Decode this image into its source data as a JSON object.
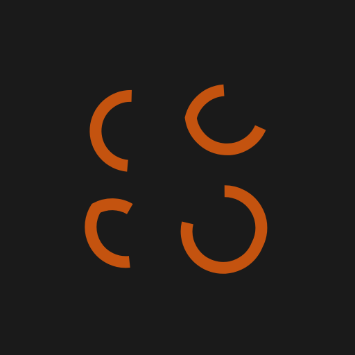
{
  "logo": {
    "icon": "four-arcs-logo-icon",
    "background_color": "#1a1a1a",
    "accent_color": "#c4530f"
  }
}
